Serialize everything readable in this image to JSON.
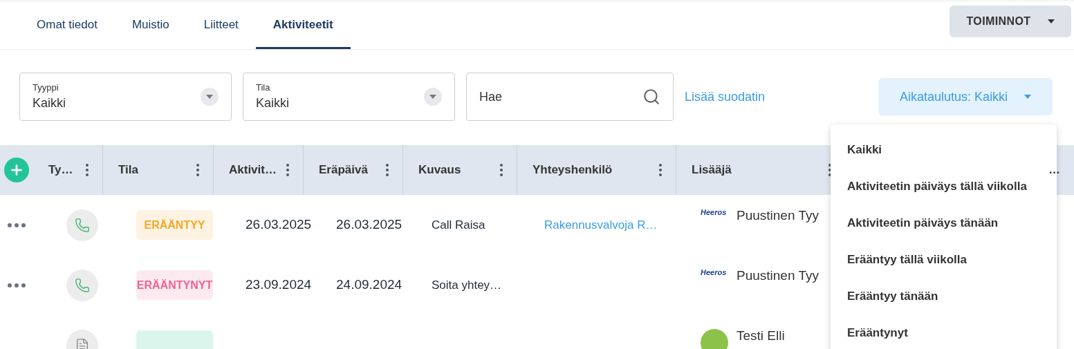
{
  "tabs": [
    {
      "label": "Omat tiedot",
      "selected": false
    },
    {
      "label": "Muistio",
      "selected": false
    },
    {
      "label": "Liitteet",
      "selected": false
    },
    {
      "label": "Aktiviteetit",
      "selected": true
    }
  ],
  "actions_button": {
    "label": "TOIMINNOT"
  },
  "filters": {
    "selects": [
      {
        "label": "Tyyppi",
        "value": "Kaikki"
      },
      {
        "label": "Tila",
        "value": "Kaikki"
      }
    ],
    "search": {
      "placeholder": "Hae"
    },
    "add_filter": "Lisää suodatin",
    "schedule_button": {
      "label": "Aikataulutus: Kaikki"
    }
  },
  "table": {
    "columns": [
      "Ty…",
      "Tila",
      "Aktivit…",
      "Eräpäivä",
      "Kuvaus",
      "Yhteyshenkilö",
      "Lisääjä",
      "…"
    ],
    "rows": [
      {
        "kind": "phone",
        "status": {
          "label": "ERÄÄNTYY",
          "color": "#f5a623"
        },
        "activity_date": "26.03.2025",
        "due_date": "26.03.2025",
        "description": "Call Raisa",
        "contact": "Rakennusvalvoja R…",
        "adder": {
          "kind": "logo",
          "logo": "Heeros",
          "name": "Puustinen Tyy"
        }
      },
      {
        "kind": "phone",
        "status": {
          "label": "ERÄÄNTYNYT",
          "color": "#f06292"
        },
        "activity_date": "23.09.2024",
        "due_date": "24.09.2024",
        "description": "Soita yhtey…",
        "adder": {
          "kind": "logo",
          "logo": "Heeros",
          "name": "Puustinen Tyy"
        }
      },
      {
        "kind": "document",
        "status": {
          "color": "#dcf5ec"
        },
        "adder": {
          "kind": "avatar",
          "name": "Testi Elli"
        }
      }
    ]
  },
  "schedule_menu": {
    "items": [
      "Kaikki",
      "Aktiviteetin päiväys tällä viikolla",
      "Aktiviteetin päiväys tänään",
      "Erääntyy tällä viikolla",
      "Erääntyy tänään",
      "Erääntynyt"
    ]
  }
}
